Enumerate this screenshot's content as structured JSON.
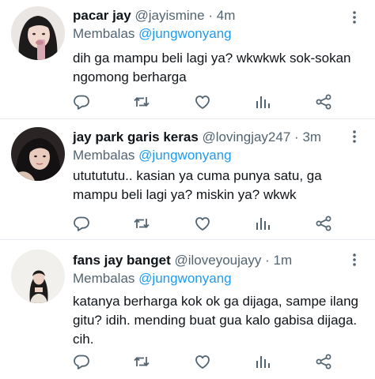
{
  "tweets": [
    {
      "name": "pacar jay",
      "handle": "@jayismine",
      "separator": "·",
      "time": "4m",
      "reply_prefix": "Membalas",
      "reply_to": "@jungwonyang",
      "text": "dih ga mampu beli lagi ya? wkwkwk sok-sokan ngomong berharga"
    },
    {
      "name": "jay park garis keras",
      "handle": "@lovingjay247",
      "separator": "·",
      "time": "3m",
      "reply_prefix": "Membalas",
      "reply_to": "@jungwonyang",
      "text": "ututututu.. kasian ya cuma punya satu, ga mampu beli lagi ya? miskin ya? wkwk"
    },
    {
      "name": "fans jay banget",
      "handle": "@iloveyoujayy",
      "separator": "·",
      "time": "1m",
      "reply_prefix": "Membalas",
      "reply_to": "@jungwonyang",
      "text": "katanya berharga kok ok ga dijaga, sampe ilang gitu? idih. mending buat gua kalo gabisa dijaga. cih."
    }
  ],
  "icons": {
    "more": "more-vertical-icon",
    "reply": "reply-bubble-icon",
    "retweet": "retweet-icon",
    "like": "heart-icon",
    "stats": "analytics-bars-icon",
    "share": "share-nodes-icon"
  },
  "colors": {
    "text": "#0f1419",
    "secondary": "#536471",
    "mention": "#1d9bf0",
    "divider": "#e6ecf0",
    "icon": "#536471"
  }
}
